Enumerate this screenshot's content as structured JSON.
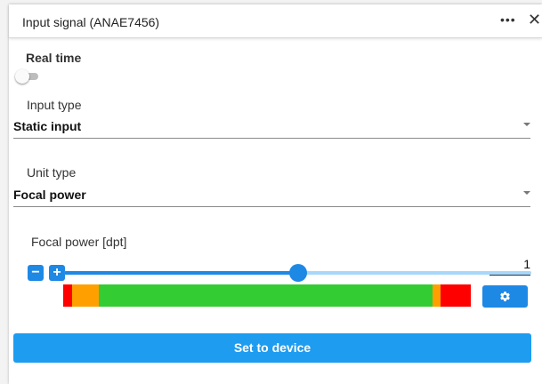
{
  "header": {
    "title": "Input signal (ANAE7456)",
    "more_icon": "more-horizontal-icon",
    "more_glyph": "•••",
    "close_icon": "close-icon",
    "close_glyph": "✕"
  },
  "realtime": {
    "label": "Real time",
    "enabled": false
  },
  "input_type": {
    "label": "Input type",
    "value": "Static input"
  },
  "unit_type": {
    "label": "Unit type",
    "value": "Focal power"
  },
  "focal_power": {
    "label": "Focal power [dpt]",
    "decrement_glyph": "−",
    "increment_glyph": "+",
    "slider_level": 0.5,
    "value": "1",
    "range_segments": [
      {
        "color": "#ff0000",
        "fraction": 0.022
      },
      {
        "color": "#ffa000",
        "fraction": 0.064
      },
      {
        "color": "#33cc33",
        "fraction": 0.801
      },
      {
        "color": "#ffa000",
        "fraction": 0.019
      },
      {
        "color": "#ff0000",
        "fraction": 0.073
      }
    ],
    "settings_icon": "gear-icon"
  },
  "actions": {
    "set_to_device": "Set to device"
  },
  "colors": {
    "accent": "#1e88e5",
    "primary_button": "#1e9cf0",
    "slider_rail": "#a7d8fb"
  }
}
